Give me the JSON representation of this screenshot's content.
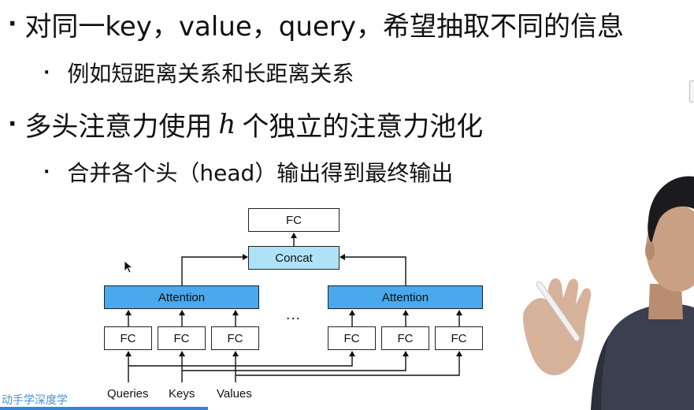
{
  "bullets": [
    {
      "text": "对同一key，value，query，希望抽取不同的信息"
    },
    {
      "text": "例如短距离关系和长距离关系"
    },
    {
      "text_before": "多头注意力使用",
      "math": "h",
      "text_after": "个独立的注意力池化"
    },
    {
      "text": "合并各个头（head）输出得到最终输出"
    }
  ],
  "diagram": {
    "fc_top": "FC",
    "concat": "Concat",
    "attention_left": "Attention",
    "attention_right": "Attention",
    "fc_labels": [
      "FC",
      "FC",
      "FC",
      "FC",
      "FC",
      "FC"
    ],
    "ellipsis": "…",
    "inputs": [
      "Queries",
      "Keys",
      "Values"
    ],
    "colors": {
      "attention": "#4aa8ec",
      "concat": "#aee3f7"
    }
  },
  "watermark": "动手学深度学",
  "progress": 0.3
}
